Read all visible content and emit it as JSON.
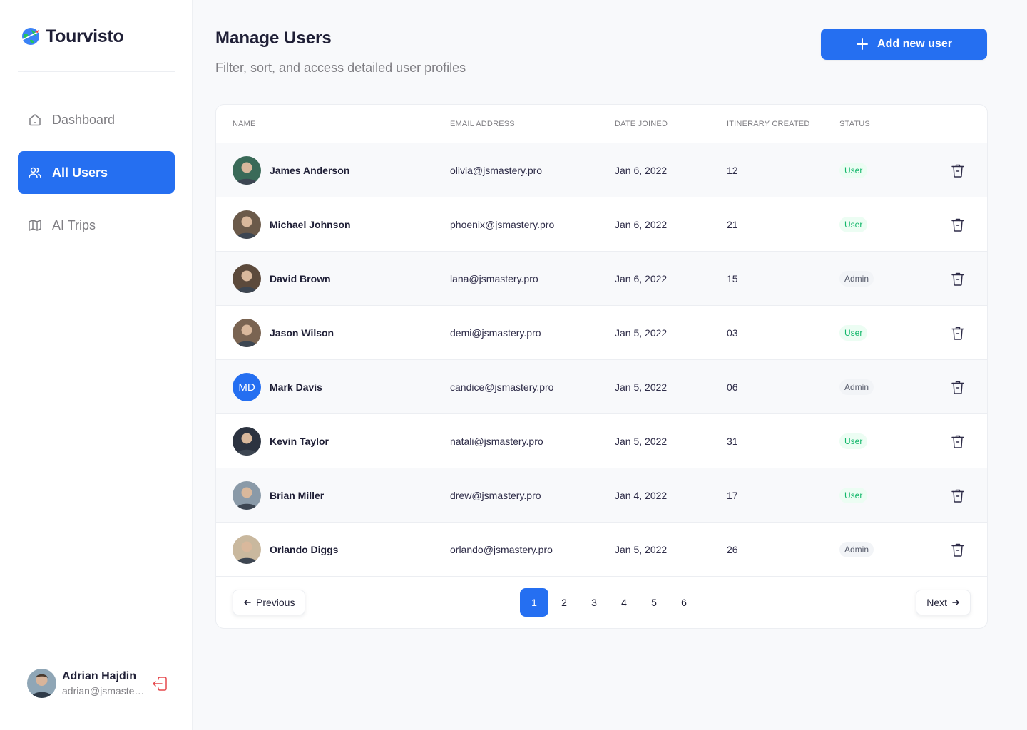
{
  "brand": {
    "name": "Tourvisto"
  },
  "sidebar": {
    "items": [
      {
        "label": "Dashboard",
        "icon": "home-icon",
        "active": false
      },
      {
        "label": "All Users",
        "icon": "users-icon",
        "active": true
      },
      {
        "label": "AI Trips",
        "icon": "map-icon",
        "active": false
      }
    ],
    "profile": {
      "name": "Adrian Hajdin",
      "email": "adrian@jsmastery.pro"
    }
  },
  "header": {
    "title": "Manage Users",
    "subtitle": "Filter, sort, and access detailed user profiles",
    "add_label": "Add new user"
  },
  "table": {
    "columns": [
      "NAME",
      "EMAIL ADDRESS",
      "DATE JOINED",
      "ITINERARY CREATED",
      "STATUS"
    ],
    "rows": [
      {
        "name": "James Anderson",
        "email": "olivia@jsmastery.pro",
        "date": "Jan 6, 2022",
        "itinerary": "12",
        "status": "User",
        "initials": "",
        "avatar_color": "#3a6a58"
      },
      {
        "name": "Michael Johnson",
        "email": "phoenix@jsmastery.pro",
        "date": "Jan 6, 2022",
        "itinerary": "21",
        "status": "User",
        "initials": "",
        "avatar_color": "#6b5a4a"
      },
      {
        "name": "David Brown",
        "email": "lana@jsmastery.pro",
        "date": "Jan 6, 2022",
        "itinerary": "15",
        "status": "Admin",
        "initials": "",
        "avatar_color": "#5c4a3c"
      },
      {
        "name": "Jason Wilson",
        "email": "demi@jsmastery.pro",
        "date": "Jan 5, 2022",
        "itinerary": "03",
        "status": "User",
        "initials": "",
        "avatar_color": "#7a6452"
      },
      {
        "name": "Mark Davis",
        "email": "candice@jsmastery.pro",
        "date": "Jan 5, 2022",
        "itinerary": "06",
        "status": "Admin",
        "initials": "MD",
        "avatar_color": "#256ff1"
      },
      {
        "name": "Kevin Taylor",
        "email": "natali@jsmastery.pro",
        "date": "Jan 5, 2022",
        "itinerary": "31",
        "status": "User",
        "initials": "",
        "avatar_color": "#2c3340"
      },
      {
        "name": "Brian Miller",
        "email": "drew@jsmastery.pro",
        "date": "Jan 4, 2022",
        "itinerary": "17",
        "status": "User",
        "initials": "",
        "avatar_color": "#8a9aa8"
      },
      {
        "name": "Orlando Diggs",
        "email": "orlando@jsmastery.pro",
        "date": "Jan 5, 2022",
        "itinerary": "26",
        "status": "Admin",
        "initials": "",
        "avatar_color": "#c9b89e"
      }
    ]
  },
  "pagination": {
    "prev_label": "Previous",
    "next_label": "Next",
    "pages": [
      "1",
      "2",
      "3",
      "4",
      "5",
      "6"
    ],
    "current": "1"
  },
  "colors": {
    "accent": "#256ff1",
    "user_badge": "#12b76a",
    "admin_badge": "#555a6a"
  }
}
